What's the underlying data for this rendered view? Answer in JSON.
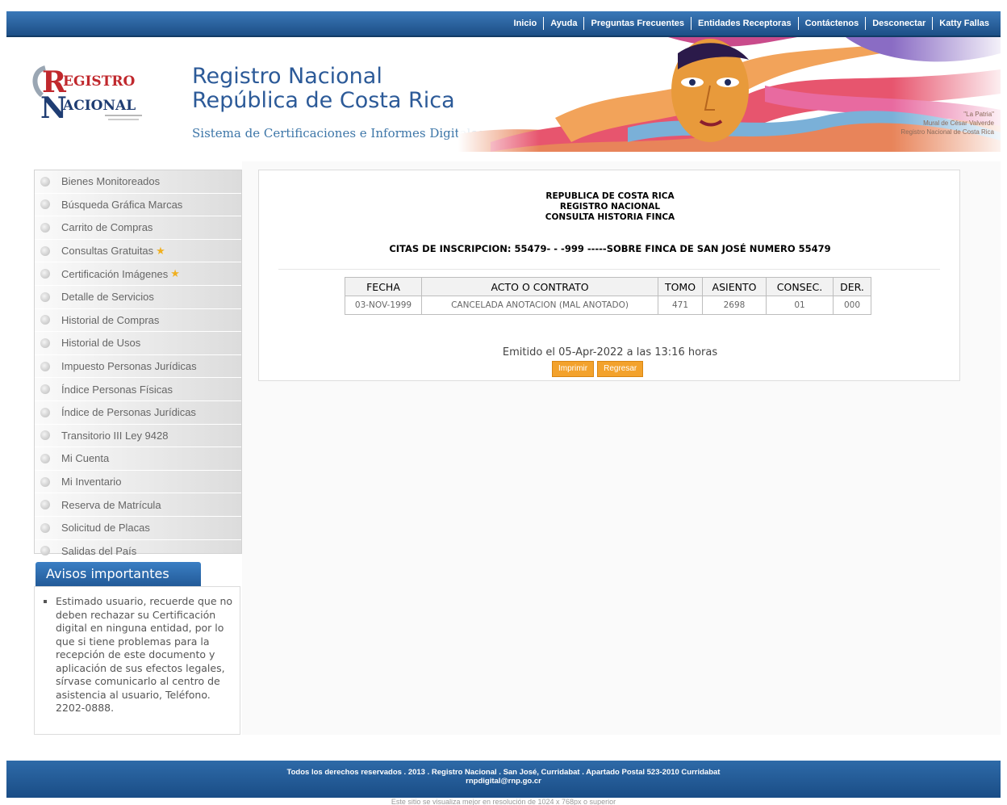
{
  "topnav": {
    "items": [
      "Inicio",
      "Ayuda",
      "Preguntas Frecuentes",
      "Entidades Receptoras",
      "Contáctenos",
      "Desconectar",
      "Katty Fallas"
    ]
  },
  "header": {
    "logo_text_1": "EGISTRO",
    "logo_text_2": "ACIONAL",
    "title_line1": "Registro Nacional",
    "title_line2": "República de Costa Rica",
    "subtitle": "Sistema de Certificaciones e Informes Digitales",
    "mural_caption_1": "\"La Patria\"",
    "mural_caption_2": "Mural de César Valverde",
    "mural_caption_3": "Registro Nacional de Costa Rica"
  },
  "sidebar": {
    "items": [
      {
        "label": "Bienes Monitoreados",
        "star": false
      },
      {
        "label": "Búsqueda Gráfica Marcas",
        "star": false
      },
      {
        "label": "Carrito de Compras",
        "star": false
      },
      {
        "label": "Consultas Gratuitas",
        "star": true
      },
      {
        "label": "Certificación Imágenes",
        "star": true
      },
      {
        "label": "Detalle de Servicios",
        "star": false
      },
      {
        "label": "Historial de Compras",
        "star": false
      },
      {
        "label": "Historial de Usos",
        "star": false
      },
      {
        "label": "Impuesto Personas Jurídicas",
        "star": false
      },
      {
        "label": "Índice Personas Físicas",
        "star": false
      },
      {
        "label": "Índice de Personas Jurídicas",
        "star": false
      },
      {
        "label": "Transitorio III Ley 9428",
        "star": false
      },
      {
        "label": "Mi Cuenta",
        "star": false
      },
      {
        "label": "Mi Inventario",
        "star": false
      },
      {
        "label": "Reserva de Matrícula",
        "star": false
      },
      {
        "label": "Solicitud de Placas",
        "star": false
      },
      {
        "label": "Salidas del País",
        "star": false
      }
    ]
  },
  "avisos": {
    "title": "Avisos importantes",
    "text": "Estimado usuario, recuerde que no deben rechazar su Certificación digital en ninguna entidad, por lo que si tiene problemas para la recepción de este documento y aplicación de sus efectos legales, sírvase comunicarlo al centro de asistencia al usuario, Teléfono. 2202-0888."
  },
  "report": {
    "head1": "REPUBLICA DE COSTA RICA",
    "head2": "REGISTRO NACIONAL",
    "head3": "CONSULTA HISTORIA FINCA",
    "citas": "CITAS DE INSCRIPCION: 55479- - -999 -----SOBRE FINCA DE SAN JOSÉ NUMERO 55479",
    "columns": [
      "FECHA",
      "ACTO O CONTRATO",
      "TOMO",
      "ASIENTO",
      "CONSEC.",
      "DER."
    ],
    "rows": [
      [
        "03-NOV-1999",
        "CANCELADA ANOTACION (MAL ANOTADO)",
        "471",
        "2698",
        "01",
        "000"
      ]
    ],
    "emitido": "Emitido el 05-Apr-2022 a las 13:16 horas",
    "btn_print": "Imprimir",
    "btn_back": "Regresar"
  },
  "footer": {
    "line1": "Todos los derechos reservados . 2013 . Registro Nacional . San José, Curridabat . Apartado Postal 523-2010 Curridabat",
    "line2": "rnpdigital@rnp.go.cr",
    "note": "Este sitio se visualiza mejor en resolución de 1024 x 768px o superior"
  },
  "colors": {
    "nav_blue": "#1d4f86",
    "accent_orange": "#f3a22c",
    "title_blue": "#2c5a98"
  }
}
